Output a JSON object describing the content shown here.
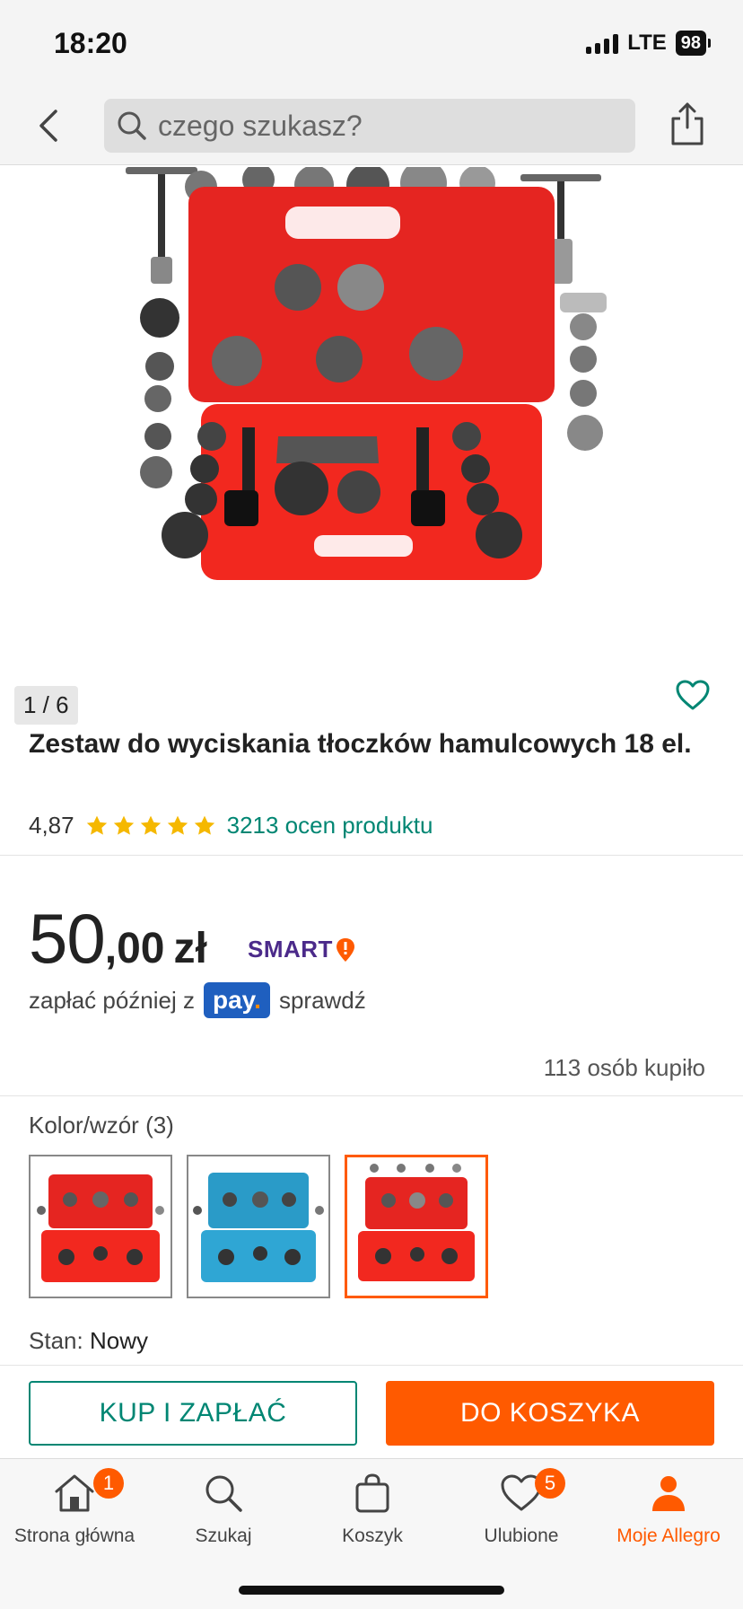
{
  "status_bar": {
    "time": "18:20",
    "network": "LTE",
    "battery": "98"
  },
  "header": {
    "search_placeholder": "czego szukasz?",
    "icons": [
      "chevron-left-icon",
      "search-icon",
      "share-icon"
    ]
  },
  "product": {
    "image_counter": "1 / 6",
    "title": "Zestaw do wyciskania tłoczków hamulcowych 18 el.",
    "rating": "4,87",
    "stars": 5,
    "reviews_link": "3213 ocen produktu",
    "price_int": "50",
    "price_dec": ",00",
    "price_cur": "zł",
    "smart_label": "SMART",
    "paylater_prefix": "zapłać później z",
    "pay_badge": "pay",
    "paylater_link": "sprawdź",
    "bought": "113 osób kupiło",
    "variant_label": "Kolor/wzór",
    "variant_count": "(3)",
    "condition_label": "Stan:",
    "condition_value": "Nowy"
  },
  "actions": {
    "buy_label": "KUP I ZAPŁAĆ",
    "cart_label": "DO KOSZYKA"
  },
  "tabbar": {
    "items": [
      {
        "label": "Strona główna",
        "icon": "home-icon",
        "badge": "1"
      },
      {
        "label": "Szukaj",
        "icon": "search-icon",
        "badge": ""
      },
      {
        "label": "Koszyk",
        "icon": "bag-icon",
        "badge": ""
      },
      {
        "label": "Ulubione",
        "icon": "heart-icon",
        "badge": "5"
      },
      {
        "label": "Moje Allegro",
        "icon": "user-icon",
        "badge": ""
      }
    ]
  },
  "colors": {
    "accent": "#ff5a00",
    "teal": "#008673",
    "star": "#f5b800",
    "smart": "#4b2a8a",
    "pay": "#1f5fbf"
  }
}
